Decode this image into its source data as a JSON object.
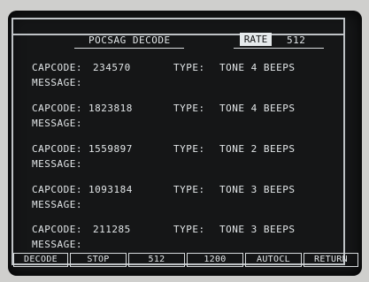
{
  "screen": {
    "title": "POCSAG DECODE",
    "rate_label": "RATE",
    "rate_value": "512"
  },
  "labels": {
    "capcode": "CAPCODE:",
    "type": "TYPE:",
    "message": "MESSAGE:"
  },
  "entries": [
    {
      "capcode": "234570",
      "type": "TONE 4 BEEPS",
      "message": ""
    },
    {
      "capcode": "1823818",
      "type": "TONE 4 BEEPS",
      "message": ""
    },
    {
      "capcode": "1559897",
      "type": "TONE 2 BEEPS",
      "message": ""
    },
    {
      "capcode": "1093184",
      "type": "TONE 3 BEEPS",
      "message": ""
    },
    {
      "capcode": "211285",
      "type": "TONE 3 BEEPS",
      "message": ""
    }
  ],
  "softkeys": [
    "DECODE",
    "STOP",
    "512",
    "1200",
    "AUTOCL",
    "RETURN"
  ]
}
